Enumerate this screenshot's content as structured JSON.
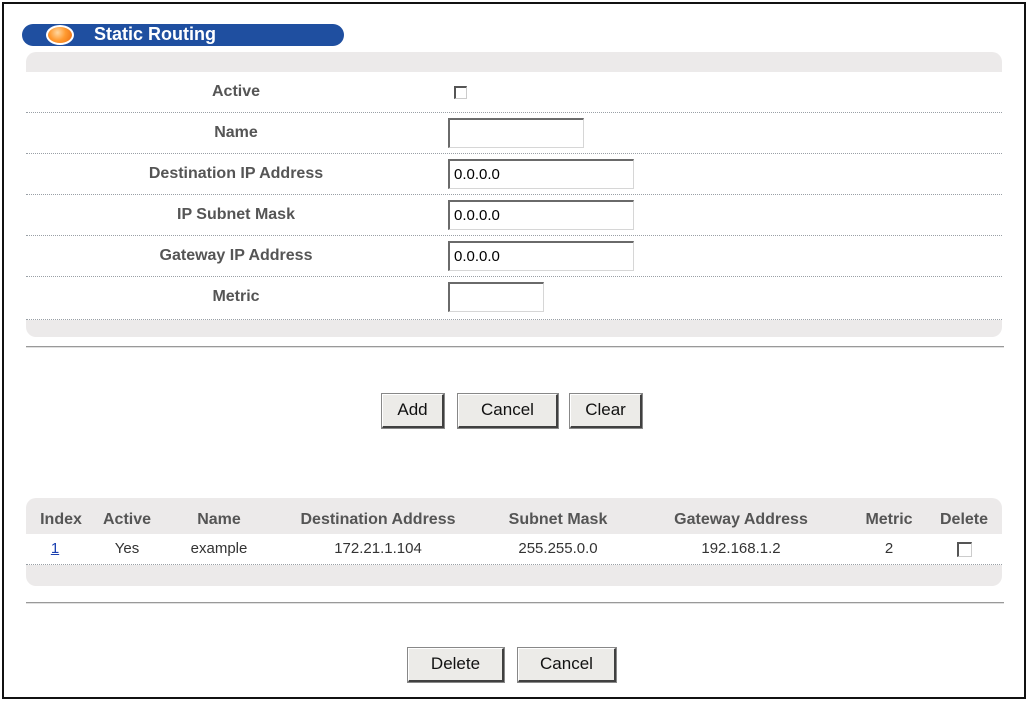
{
  "title": "Static Routing",
  "form": {
    "active_label": "Active",
    "name_label": "Name",
    "dest_label": "Destination IP Address",
    "subnet_label": "IP Subnet Mask",
    "gateway_label": "Gateway IP Address",
    "metric_label": "Metric",
    "name_value": "",
    "dest_value": "0.0.0.0",
    "subnet_value": "0.0.0.0",
    "gateway_value": "0.0.0.0",
    "metric_value": ""
  },
  "form_buttons": {
    "add": "Add",
    "cancel": "Cancel",
    "clear": "Clear"
  },
  "table": {
    "headers": {
      "index": "Index",
      "active": "Active",
      "name": "Name",
      "destination": "Destination Address",
      "subnet": "Subnet Mask",
      "gateway": "Gateway Address",
      "metric": "Metric",
      "delete": "Delete"
    },
    "rows": [
      {
        "index": "1",
        "active": "Yes",
        "name": "example",
        "destination": "172.21.1.104",
        "subnet": "255.255.0.0",
        "gateway": "192.168.1.2",
        "metric": "2"
      }
    ]
  },
  "table_buttons": {
    "delete": "Delete",
    "cancel": "Cancel"
  },
  "colors": {
    "title_bar": "#1f4fa0",
    "panel": "#eceaea",
    "link": "#1a3fb0"
  }
}
